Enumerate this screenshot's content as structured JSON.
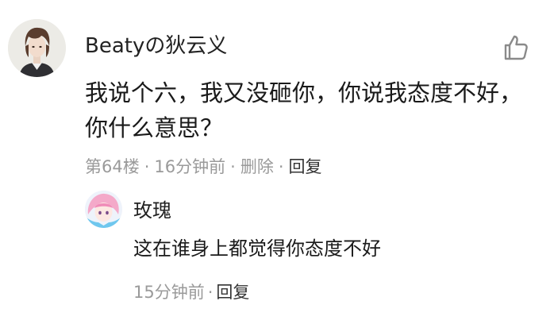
{
  "comment": {
    "author": "Beatyの狄云义",
    "text": "我说个六，我又没砸你，你说我态度不好，你什么意思？",
    "floor": "第64楼",
    "time": "16分钟前",
    "delete_label": "删除",
    "reply_label": "回复",
    "separator": "·"
  },
  "reply": {
    "author": "玫瑰",
    "text": "这在谁身上都觉得你态度不好",
    "time": "15分钟前",
    "separator": "·",
    "reply_label": "回复"
  },
  "icons": {
    "like": "thumbs-up-icon"
  }
}
